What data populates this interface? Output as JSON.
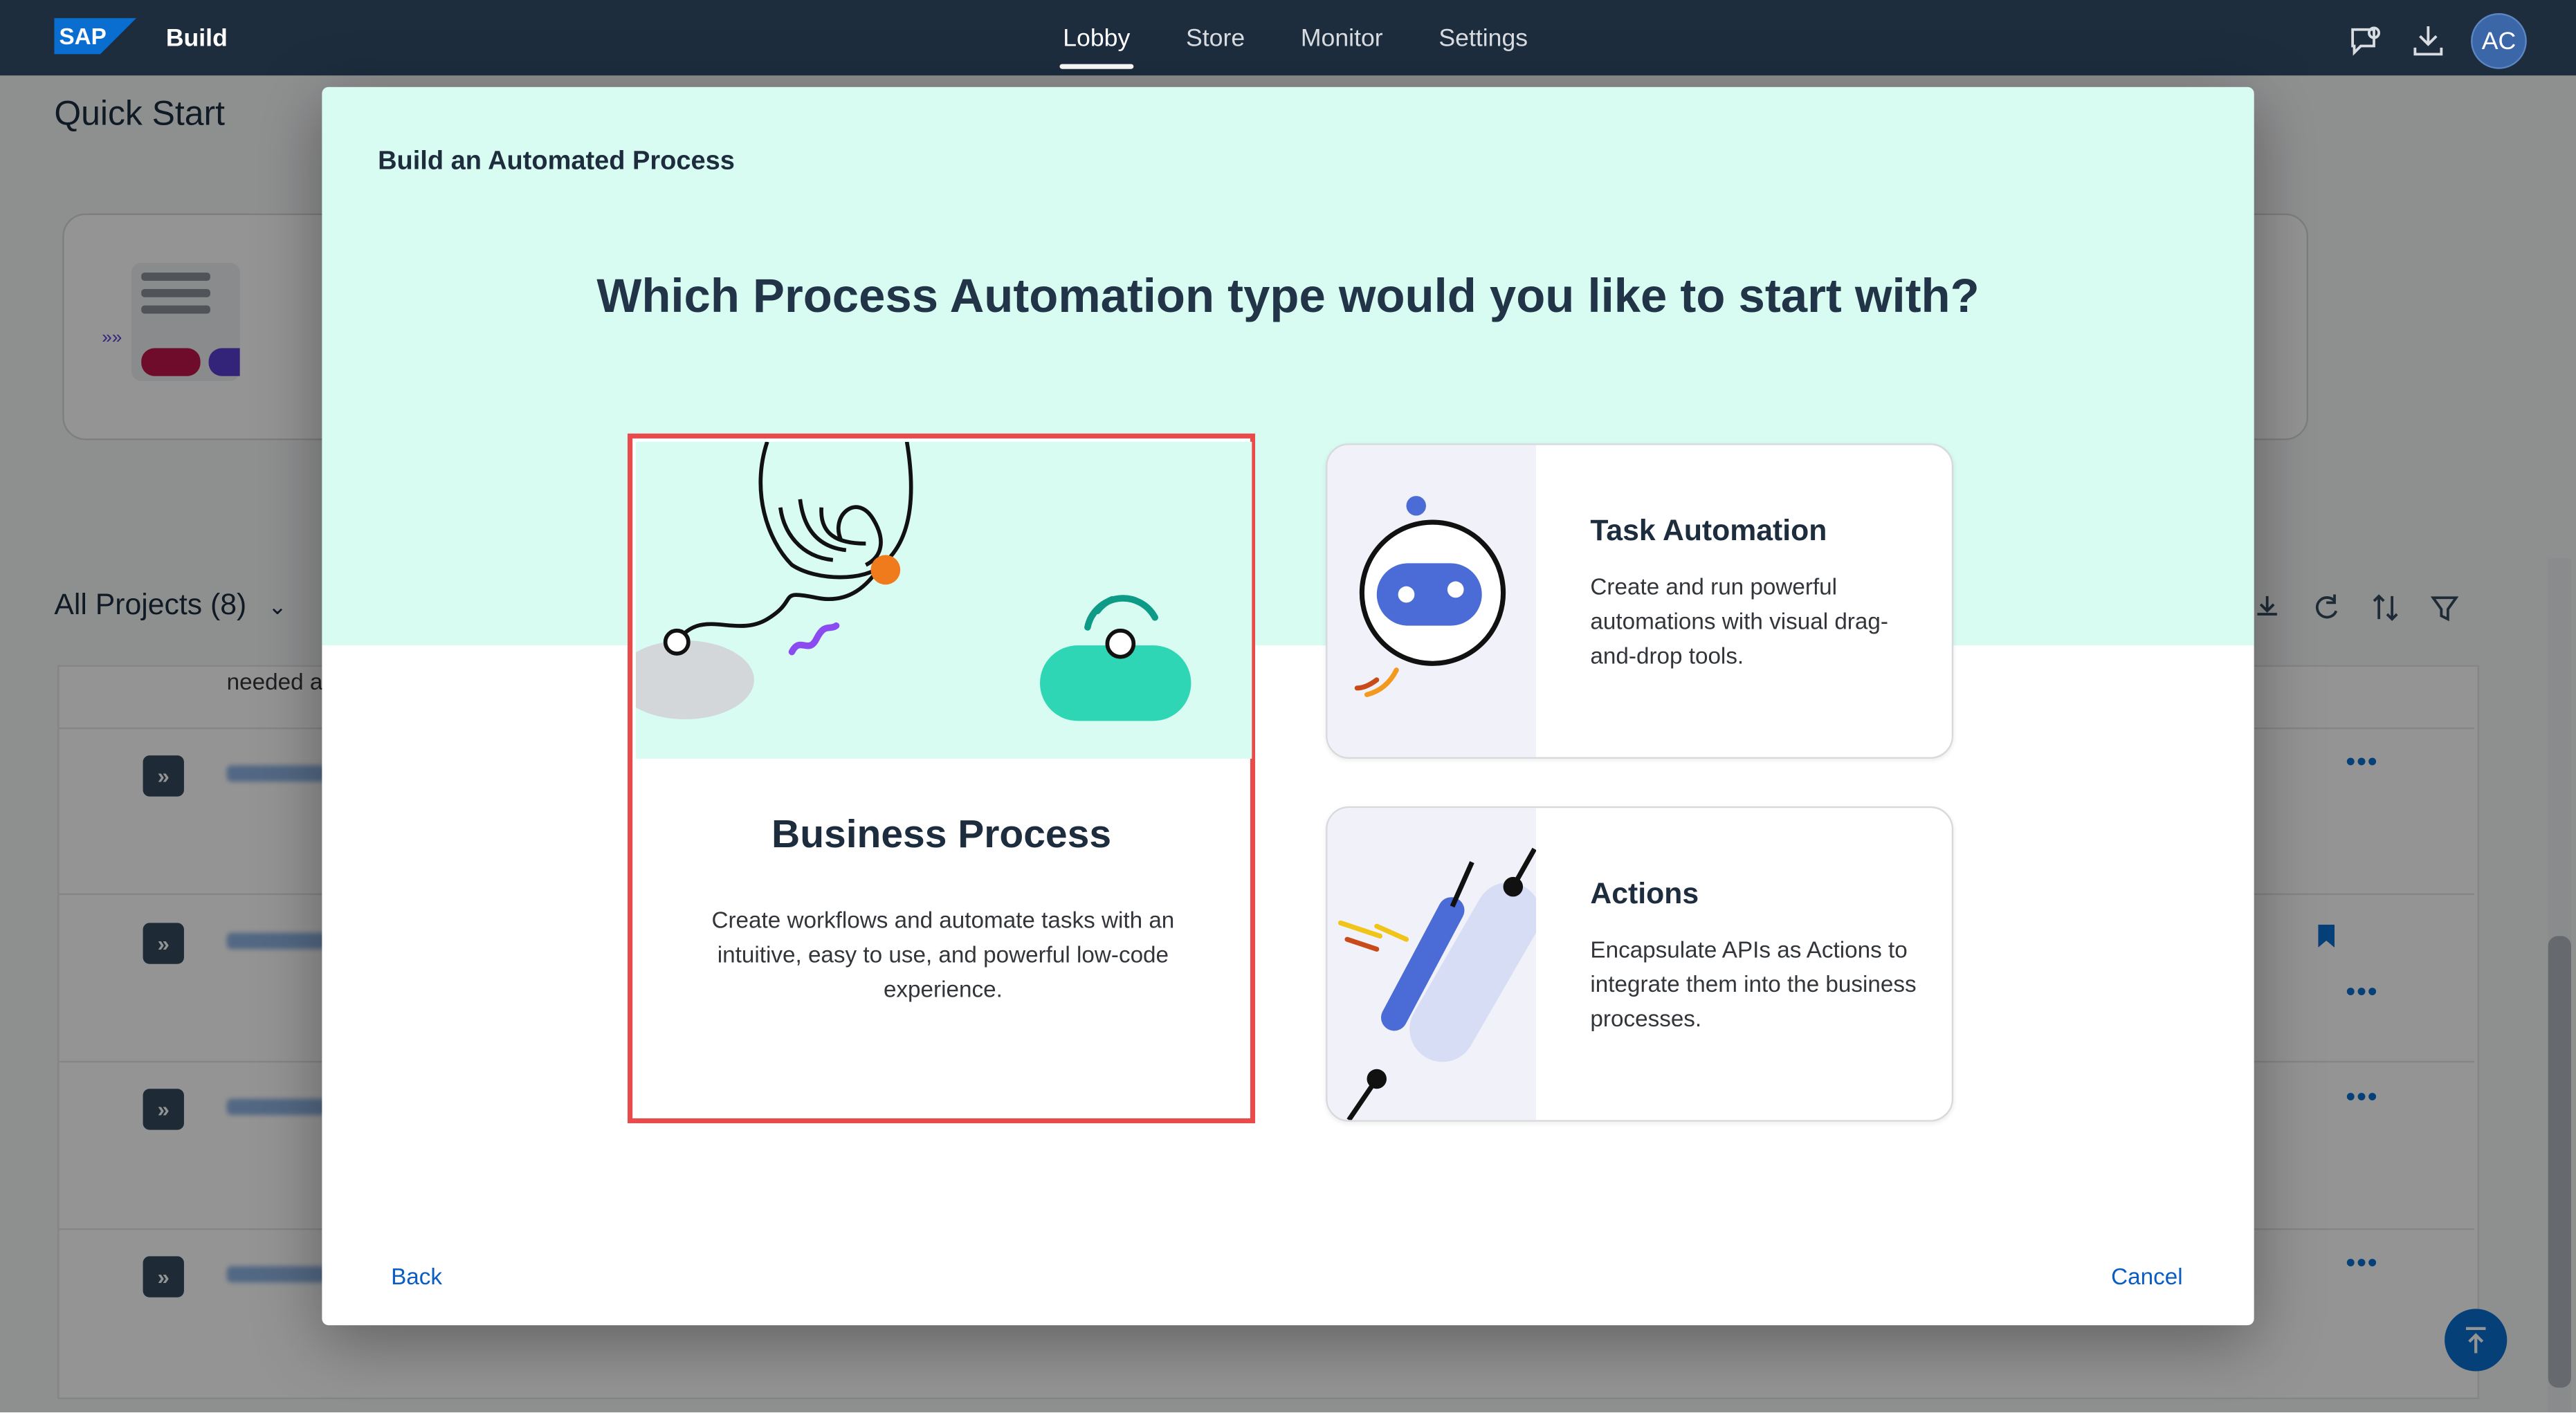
{
  "shell": {
    "product": "Build",
    "nav": [
      {
        "label": "Lobby",
        "active": true
      },
      {
        "label": "Store",
        "active": false
      },
      {
        "label": "Monitor",
        "active": false
      },
      {
        "label": "Settings",
        "active": false
      }
    ],
    "avatar_initials": "AC",
    "icons": [
      "feedback-icon",
      "download-icon"
    ]
  },
  "background": {
    "quick_start_title": "Quick Start",
    "projects_heading": "All Projects (8)",
    "partial_text": "needed a"
  },
  "dialog": {
    "title": "Build an Automated Process",
    "question": "Which Process Automation type would you like to start with?",
    "options": [
      {
        "title": "Business Process",
        "description": "Create workflows and automate tasks with an intuitive, easy to use, and powerful low-code experience.",
        "selected": true
      },
      {
        "title": "Task Automation",
        "description": "Create and run powerful automations with visual drag-and-drop tools.",
        "selected": false
      },
      {
        "title": "Actions",
        "description": "Encapsulate APIs as Actions to integrate them into the business processes.",
        "selected": false
      }
    ],
    "back_label": "Back",
    "cancel_label": "Cancel"
  },
  "colors": {
    "shell_bg": "#1d2d3e",
    "dialog_header_bg": "#d8fbf2",
    "selection_border": "#e94b4b",
    "link": "#0a5dc2"
  }
}
